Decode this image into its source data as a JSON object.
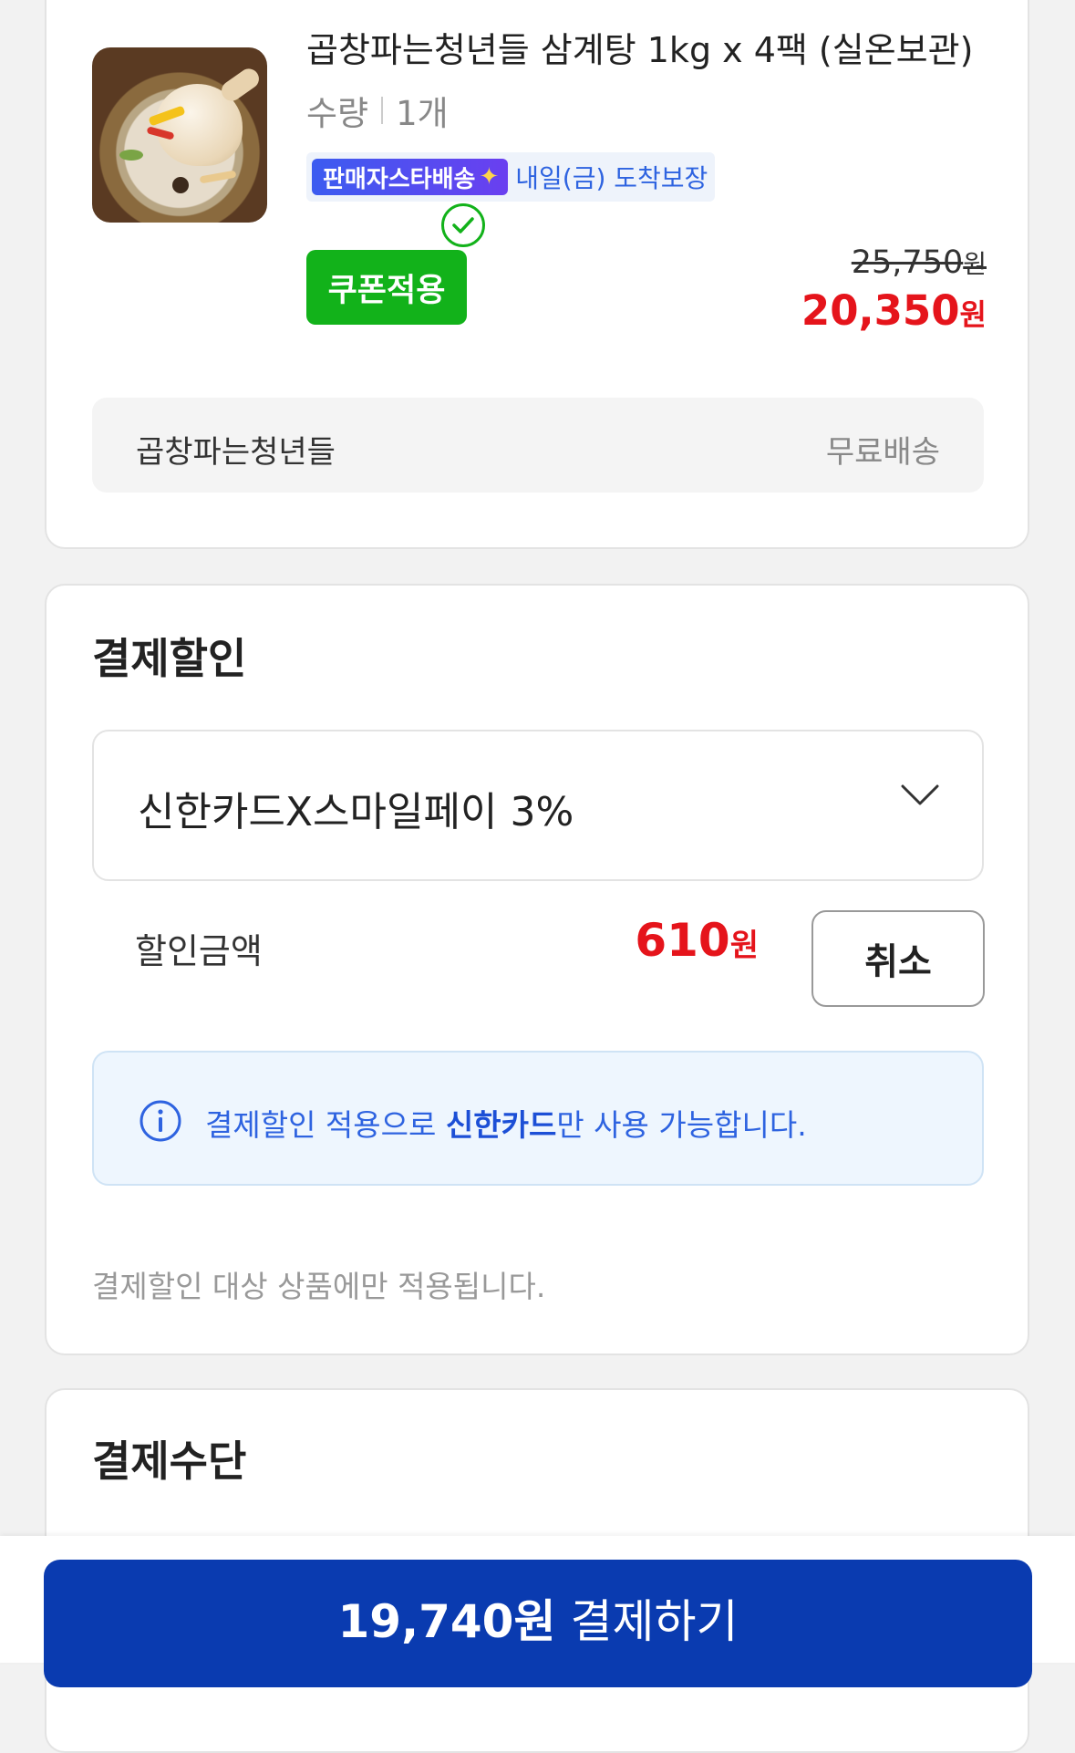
{
  "product": {
    "name": "곱창파는청년들 삼계탕 1kg x 4팩 (실온보관)",
    "quantity_label": "수량",
    "quantity_value": "1개",
    "delivery_badge": "판매자스타배송",
    "delivery_text": "내일(금) 도착보장",
    "coupon_label": "쿠폰적용",
    "original_price": "25,750",
    "sale_price": "20,350",
    "currency": "원",
    "seller": "곱창파는청년들",
    "shipping": "무료배송"
  },
  "discount": {
    "title": "결제할인",
    "selected_option": "신한카드X스마일페이 3%",
    "amount_label": "할인금액",
    "amount": "610",
    "currency": "원",
    "cancel_label": "취소",
    "info_prefix": "결제할인 적용으로 ",
    "info_highlight": "신한카드",
    "info_suffix": "만 사용 가능합니다.",
    "note": "결제할인 대상 상품에만 적용됩니다."
  },
  "payment": {
    "title": "결제수단"
  },
  "checkout": {
    "amount": "19,740원",
    "label": "결제하기"
  },
  "colors": {
    "accent_red": "#e5141b",
    "coupon_green": "#12b21a",
    "primary_blue": "#0a3bb0",
    "info_blue": "#2e63e0"
  }
}
